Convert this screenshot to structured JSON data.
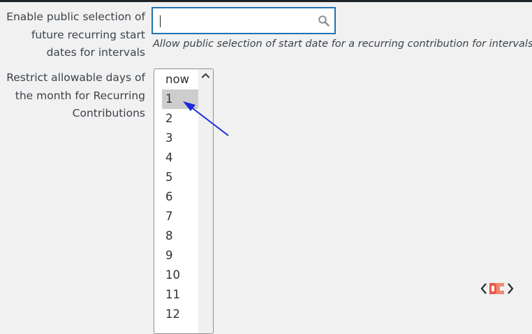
{
  "fields": {
    "public_selection": {
      "label": "Enable public selection of future recurring start dates for intervals",
      "input_value": "",
      "description": "Allow public selection of start date for a recurring contribution for intervals"
    },
    "restrict_days": {
      "label": "Restrict allowable days of the month for Recurring Contributions",
      "options": [
        "now",
        "1",
        "2",
        "3",
        "4",
        "5",
        "6",
        "7",
        "8",
        "9",
        "10",
        "11",
        "12"
      ],
      "selected": "1"
    }
  },
  "icons": {
    "search": "search-icon",
    "scroll_up": "chevron-up-icon",
    "annotation": "arrow-icon",
    "watermark": "logo-icon"
  },
  "colors": {
    "focus_border": "#2271b1",
    "arrow": "#1a2ad6",
    "selected_option_bg": "#cdcdcd",
    "logo_red": "#e8594a"
  }
}
